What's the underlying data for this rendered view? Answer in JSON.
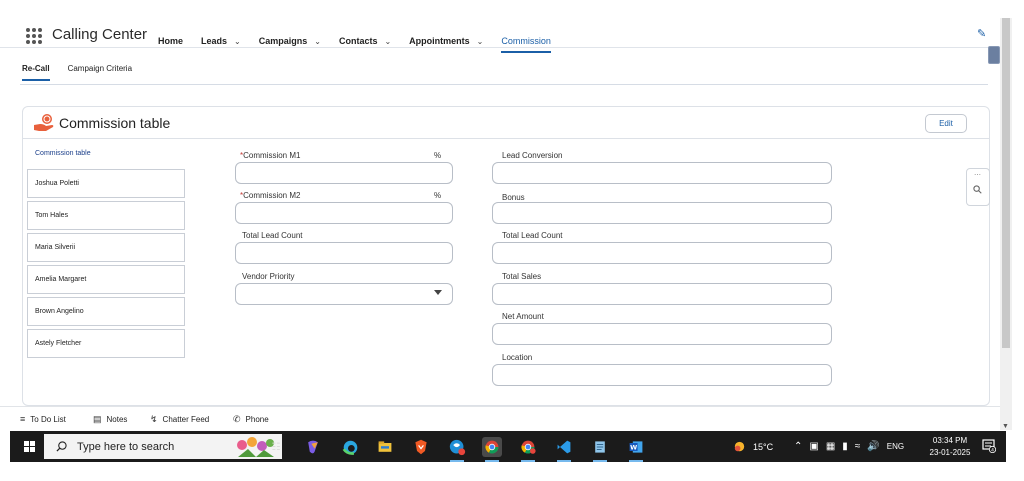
{
  "app": {
    "name": "Calling Center",
    "nav": [
      {
        "label": "Home",
        "dropdown": false,
        "active": false
      },
      {
        "label": "Leads",
        "dropdown": true,
        "active": false
      },
      {
        "label": "Campaigns",
        "dropdown": true,
        "active": false
      },
      {
        "label": "Contacts",
        "dropdown": true,
        "active": false
      },
      {
        "label": "Appointments",
        "dropdown": true,
        "active": false
      },
      {
        "label": "Commission",
        "dropdown": false,
        "active": true
      }
    ]
  },
  "subtabs": [
    {
      "label": "Re-Call",
      "active": true
    },
    {
      "label": "Campaign Criteria",
      "active": false
    }
  ],
  "card": {
    "title": "Commission table",
    "edit_label": "Edit",
    "list_header": "Commission table",
    "list_items": [
      "Joshua Poletti",
      "Tom Hales",
      "Maria Silverii",
      "Amelia Margaret",
      "Brown Angelino",
      "Astely Fletcher"
    ]
  },
  "form": {
    "left": [
      {
        "label": "Commission M1",
        "required": true,
        "suffix": "%",
        "type": "text",
        "value": ""
      },
      {
        "label": "Commission M2",
        "required": true,
        "suffix": "%",
        "type": "text",
        "value": ""
      },
      {
        "label": "Total Lead Count",
        "required": false,
        "suffix": "",
        "type": "text",
        "value": ""
      },
      {
        "label": "Vendor Priority",
        "required": false,
        "suffix": "",
        "type": "select",
        "value": ""
      }
    ],
    "right": [
      {
        "label": "Lead Conversion",
        "value": ""
      },
      {
        "label": "Bonus",
        "value": ""
      },
      {
        "label": "Total Lead Count",
        "value": ""
      },
      {
        "label": "Total Sales",
        "value": ""
      },
      {
        "label": "Net Amount",
        "value": ""
      },
      {
        "label": "Location",
        "value": ""
      }
    ]
  },
  "utility_bar": [
    {
      "label": "To Do List",
      "icon": "list-icon"
    },
    {
      "label": "Notes",
      "icon": "notes-icon"
    },
    {
      "label": "Chatter Feed",
      "icon": "bolt-icon"
    },
    {
      "label": "Phone",
      "icon": "phone-icon"
    }
  ],
  "taskbar": {
    "search_placeholder": "Type here to search",
    "temperature": "15°C",
    "language": "ENG",
    "time": "03:34 PM",
    "date": "23-01-2025",
    "notification_count": "4"
  },
  "colors": {
    "accent": "#1b5fa7",
    "required": "#c23934",
    "taskbar": "#1b1b1b"
  }
}
